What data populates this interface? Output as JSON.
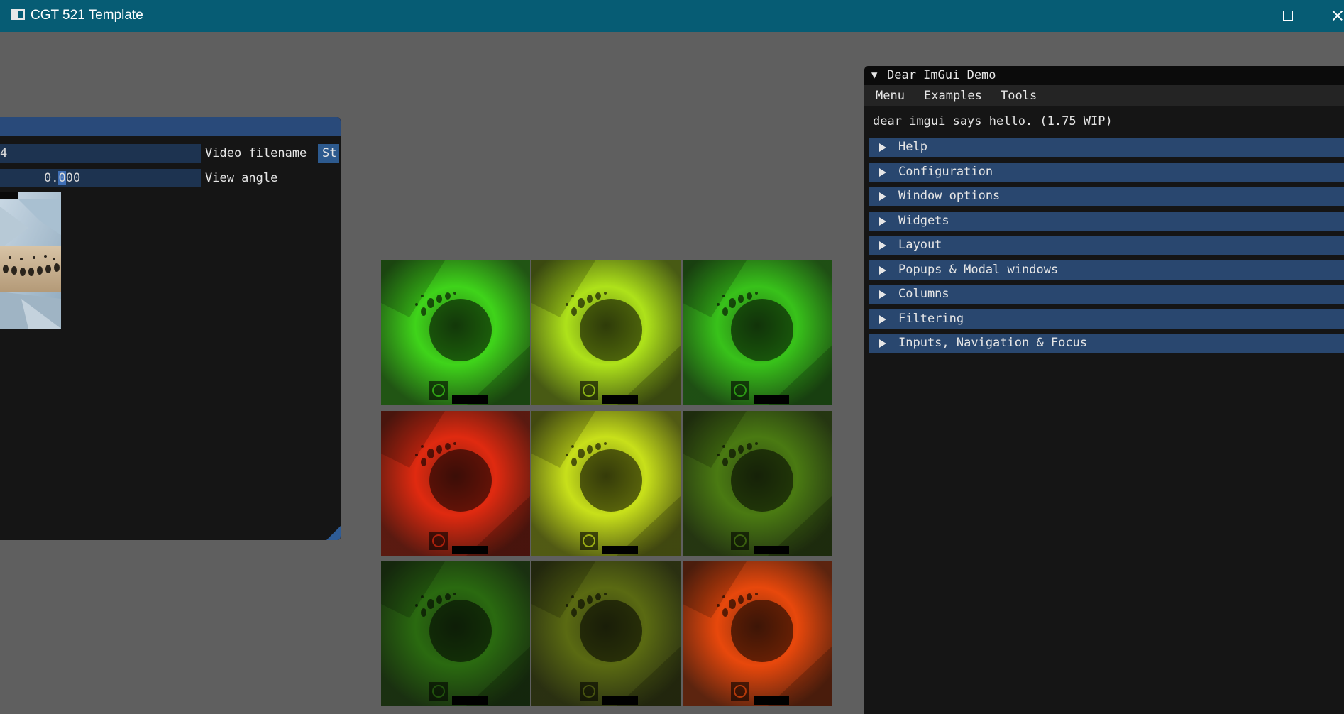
{
  "window": {
    "title": "CGT 521 Template",
    "controls": [
      "minimize-icon",
      "maximize-icon",
      "close-icon"
    ]
  },
  "left_panel": {
    "filename_value": "4",
    "filename_label": "Video filename",
    "start_button_label": "St",
    "angle_value_before_sel": "0.",
    "angle_value_selected": "0",
    "angle_value_after_sel": "00",
    "angle_label": "View angle"
  },
  "texture_grid": {
    "tint_colors": [
      [
        "#3fd41a",
        "#aee21a",
        "#38c21a"
      ],
      [
        "#e02a10",
        "#c8e01a",
        "#4a7a12"
      ],
      [
        "#2a6a10",
        "#5a6a12",
        "#e8480c"
      ]
    ]
  },
  "demo": {
    "title": "Dear ImGui Demo",
    "menu": [
      "Menu",
      "Examples",
      "Tools"
    ],
    "hello": "dear imgui says hello. (1.75 WIP)",
    "headers": [
      "Help",
      "Configuration",
      "Window options",
      "Widgets",
      "Layout",
      "Popups & Modal windows",
      "Columns",
      "Filtering",
      "Inputs, Navigation & Focus"
    ]
  },
  "colors": {
    "os_titlebar": "#065c74",
    "viewport_bg": "#5f5f5f",
    "window_bg": "#151515",
    "header_bg": "#29476f",
    "frame_bg": "#1d3350"
  }
}
